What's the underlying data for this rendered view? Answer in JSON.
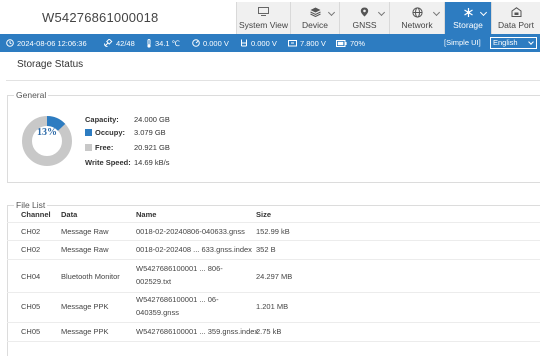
{
  "header": {
    "device_id": "W54276861000018",
    "tabs": [
      {
        "label": "System View",
        "icon": "monitor-icon",
        "active": false
      },
      {
        "label": "Device",
        "icon": "stack-icon",
        "active": false
      },
      {
        "label": "GNSS",
        "icon": "location-pin-icon",
        "active": false
      },
      {
        "label": "Network",
        "icon": "globe-icon",
        "active": false
      },
      {
        "label": "Storage",
        "icon": "storage-icon",
        "active": true
      },
      {
        "label": "Data Port",
        "icon": "data-port-icon",
        "active": false
      }
    ]
  },
  "statusbar": {
    "datetime": "2024-08-06 12:06:36",
    "satellites": "42/48",
    "temperature": "34.1 ℃",
    "voltage1": "0.000 V",
    "voltage2": "0.000 V",
    "voltage3": "7.800 V",
    "battery": "70%",
    "simple_ui": "[Simple UI]",
    "language": "English"
  },
  "page": {
    "title": "Storage Status"
  },
  "general": {
    "legend": "General",
    "percent": "13%",
    "capacity_label": "Capacity:",
    "capacity": "24.000 GB",
    "occupy_label": "Occupy:",
    "occupy": "3.079 GB",
    "free_label": "Free:",
    "free": "20.921 GB",
    "write_speed_label": "Write Speed:",
    "write_speed": "14.69 kB/s",
    "used_fraction": 0.13,
    "colors": {
      "occupy": "#2d7cc1",
      "free": "#c8c8c8"
    }
  },
  "file_list": {
    "legend": "File List",
    "columns": [
      "Channel",
      "Data",
      "Name",
      "Size"
    ],
    "rows": [
      {
        "channel": "CH02",
        "data": "Message Raw",
        "name": [
          "0018-02-20240806-040633.gnss"
        ],
        "size": "152.99 kB"
      },
      {
        "channel": "CH02",
        "data": "Message Raw",
        "name": [
          "0018-02-202408 ... 633.gnss.index"
        ],
        "size": "352 B"
      },
      {
        "channel": "CH04",
        "data": "Bluetooth Monitor",
        "name": [
          "W5427686100001 ... 806-",
          "002529.txt"
        ],
        "size": "24.297 MB"
      },
      {
        "channel": "CH05",
        "data": "Message PPK",
        "name": [
          "W5427686100001 ... 06-",
          "040359.gnss"
        ],
        "size": "1.201 MB"
      },
      {
        "channel": "CH05",
        "data": "Message PPK",
        "name": [
          "W5427686100001 ... 359.gnss.index"
        ],
        "size": "2.75 kB"
      }
    ]
  },
  "colors": {
    "accent": "#2d7cc1",
    "tab_bg": "#f0f0f0"
  }
}
